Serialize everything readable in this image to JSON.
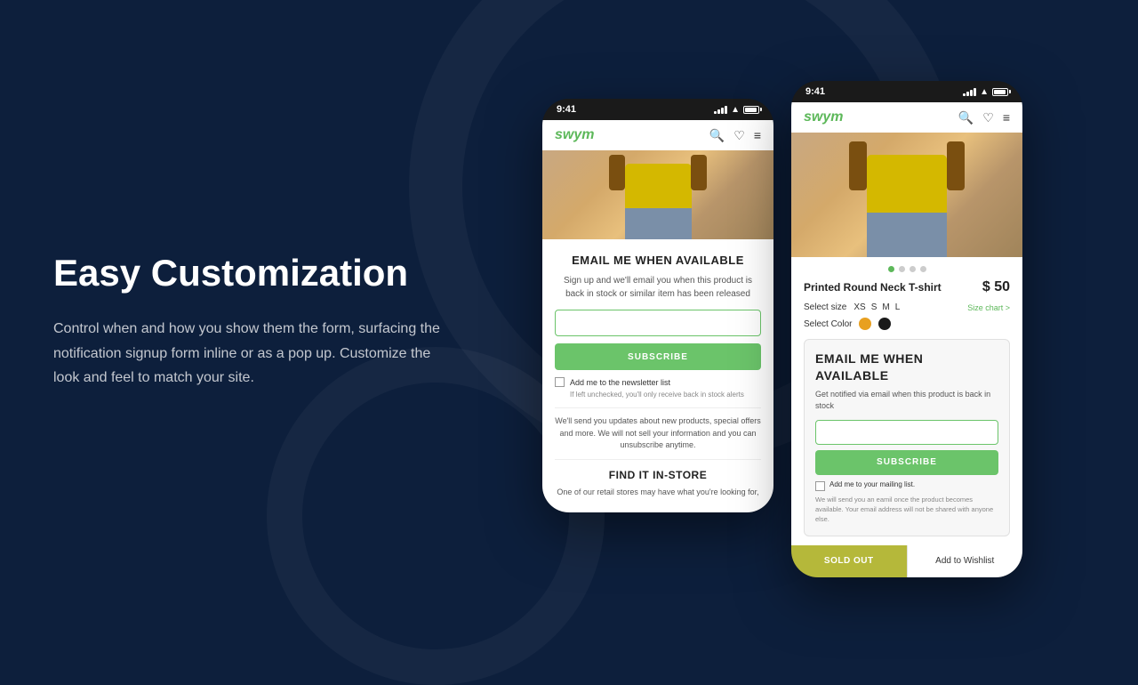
{
  "page": {
    "background_color": "#0d1f3c"
  },
  "left_section": {
    "title": "Easy Customization",
    "description": "Control when and how you show them the form, surfacing the notification signup form inline or as a pop up. Customize the look and feel to match your site."
  },
  "phone_left": {
    "status_bar": {
      "time": "9:41"
    },
    "app_logo": "swym",
    "product_image_alt": "Yellow t-shirt product",
    "form": {
      "title": "EMAIL ME WHEN AVAILABLE",
      "description": "Sign up and we'll email you when this product is back in stock or similar item has been released",
      "email_placeholder": "",
      "subscribe_label": "SUBSCRIBE",
      "newsletter_label": "Add me to the newsletter list",
      "newsletter_hint": "If left unchecked, you'll only receive back in stock alerts",
      "promo_text": "We'll send you updates about new products, special offers and more. We will not sell your information and you can unsubscribe anytime.",
      "find_store_title": "FIND IT IN-STORE",
      "find_store_desc": "One of our retail stores may have what you're looking for,"
    }
  },
  "phone_right": {
    "status_bar": {
      "time": "9:41"
    },
    "app_logo": "swym",
    "product_image_alt": "Yellow t-shirt product",
    "product": {
      "name": "Printed Round Neck T-shirt",
      "price": "$ 50",
      "size_label": "Select size",
      "sizes": [
        "XS",
        "S",
        "M",
        "L"
      ],
      "size_chart_label": "Size chart >",
      "color_label": "Select Color",
      "colors": [
        "orange",
        "black"
      ]
    },
    "widget": {
      "title": "EMAIL ME WHEN AVAILABLE",
      "description": "Get notified via email when this product is back in stock",
      "email_placeholder": "",
      "subscribe_label": "SUBSCRIBE",
      "mailing_label": "Add me to your mailing list.",
      "privacy_text": "We will send you an eamil once the product becomes available. Your email address will not be shared with anyone else."
    },
    "actions": {
      "sold_out_label": "SOLD OUT",
      "wishlist_label": "Add to Wishlist"
    },
    "indicators": [
      true,
      false,
      false,
      false
    ]
  }
}
